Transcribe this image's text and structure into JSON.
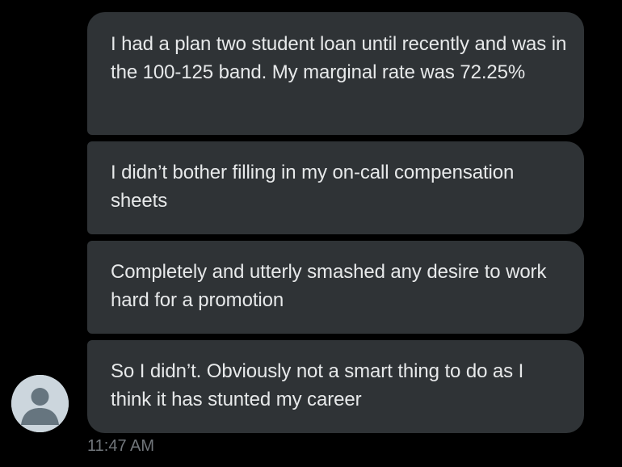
{
  "messages": [
    {
      "text": "I had a plan two student loan until recently and was in the 100-125 band. My marginal rate was 72.25%"
    },
    {
      "text": "I didn’t bother filling in my on-call compensation sheets"
    },
    {
      "text": "Completely and utterly smashed any desire to work hard for a promotion"
    },
    {
      "text": "So I didn’t. Obviously not a smart thing to do as I think it has stunted my career"
    }
  ],
  "timestamp": "11:47 AM",
  "avatar": {
    "icon": "default-profile-icon"
  },
  "colors": {
    "background": "#000000",
    "bubble": "#2f3336",
    "text": "#e7e9ea",
    "timestamp": "#71767b",
    "avatar_bg": "#ccd6dd",
    "avatar_fg": "#66757f"
  }
}
